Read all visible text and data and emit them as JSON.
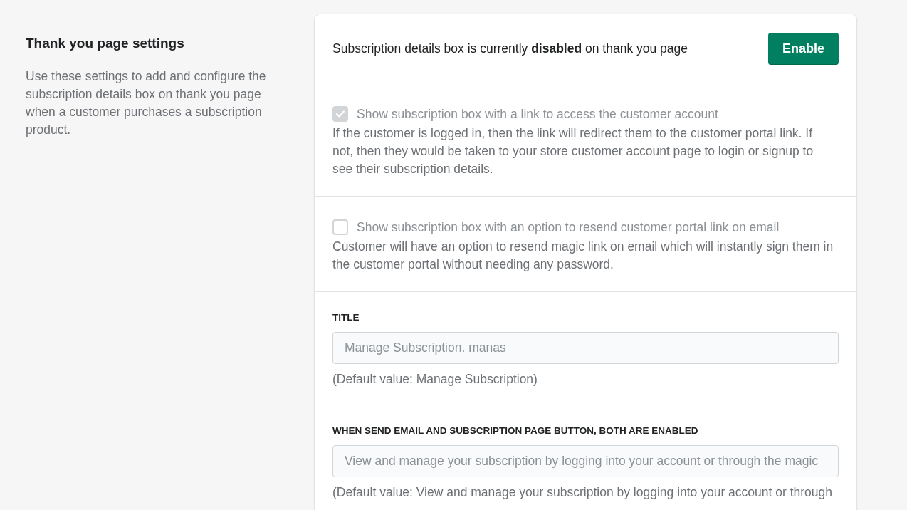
{
  "settings_intro": {
    "title": "Thank you page settings",
    "description": "Use these settings to add and configure the subscription details box on thank you page when a customer purchases a subscription product."
  },
  "status_banner": {
    "text": "Subscription details box is currently **disabled** on thank you page",
    "button": "Enable"
  },
  "options": [
    {
      "label": "Show subscription box with a link to access the customer account",
      "checked": true,
      "disabled": true,
      "description": "If the customer is logged in, then the link will redirect them to the customer portal link. If not, then they would be taken to your store customer account page to login or signup to see their subscription details."
    },
    {
      "label": "Show subscription box with an option to resend customer portal link on email",
      "checked": false,
      "disabled": true,
      "description": "Customer will have an option to resend magic link on email which will instantly sign them in the customer portal without needing any password."
    }
  ],
  "fields": [
    {
      "label": "TITLE",
      "value": "Manage Subscription. manas",
      "disabled": true,
      "help": "(Default value: Manage Subscription)"
    },
    {
      "label": "WHEN SEND EMAIL AND SUBSCRIPTION PAGE BUTTON, BOTH ARE ENABLED",
      "value": "View and manage your subscription by logging into your account or through the magic",
      "disabled": true,
      "help": "(Default value: View and manage your subscription by logging into your account or through"
    }
  ]
}
